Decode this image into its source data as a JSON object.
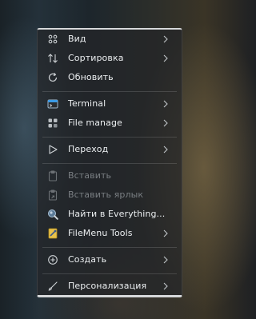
{
  "menu": {
    "items": [
      {
        "label": "Вид",
        "icon": "grid-icon",
        "submenu": true
      },
      {
        "label": "Сортировка",
        "icon": "sort-arrows-icon",
        "submenu": true
      },
      {
        "label": "Обновить",
        "icon": "refresh-icon",
        "submenu": false
      },
      {
        "label": "Terminal",
        "icon": "terminal-icon",
        "submenu": true
      },
      {
        "label": "File manage",
        "icon": "file-manage-icon",
        "submenu": true
      },
      {
        "label": "Переход",
        "icon": "play-outline-icon",
        "submenu": true
      },
      {
        "label": "Вставить",
        "icon": "paste-icon",
        "submenu": false,
        "disabled": true
      },
      {
        "label": "Вставить ярлык",
        "icon": "paste-shortcut-icon",
        "submenu": false,
        "disabled": true
      },
      {
        "label": "Найти в Everything...",
        "icon": "everything-search-icon",
        "submenu": false
      },
      {
        "label": "FileMenu Tools",
        "icon": "filemenu-tools-icon",
        "submenu": true
      },
      {
        "label": "Создать",
        "icon": "plus-circle-icon",
        "submenu": true
      },
      {
        "label": "Персонализация",
        "icon": "brush-icon",
        "submenu": true
      }
    ]
  },
  "colors": {
    "menu_background": "#242628",
    "text": "#eceff1",
    "disabled_text": "#7a7f83",
    "terminal_accent": "#3b9be6",
    "filemenu_accent": "#e8c14a"
  }
}
